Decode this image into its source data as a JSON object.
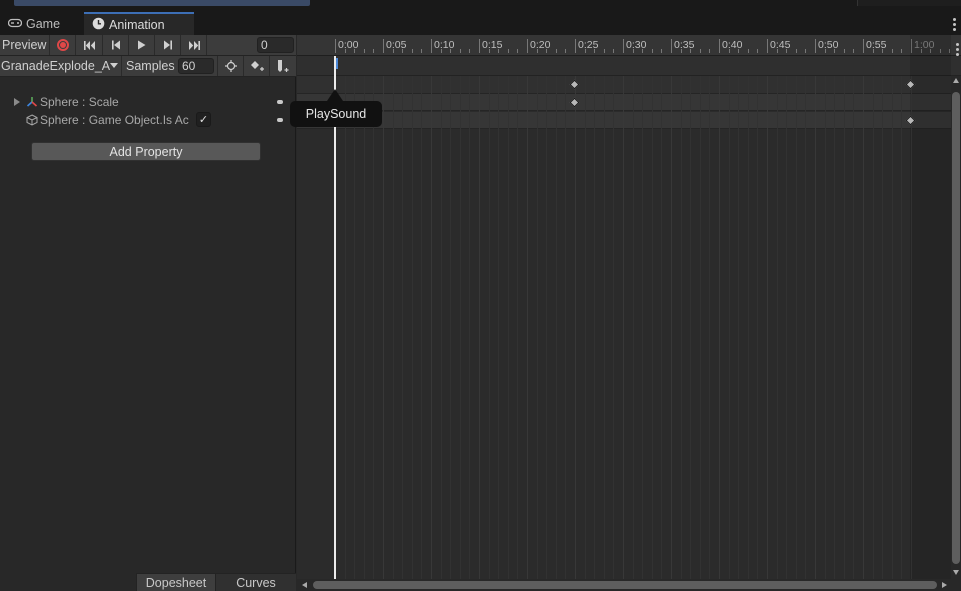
{
  "window": {
    "tabs": [
      {
        "label": "Game",
        "icon": "gamepad-icon"
      },
      {
        "label": "Animation",
        "icon": "clock-icon",
        "active": true
      }
    ]
  },
  "toolbar": {
    "preview_label": "Preview",
    "frame_value": "0",
    "clip_name": "GranadeExplode_Ar",
    "samples_label": "Samples",
    "samples_value": "60"
  },
  "properties": [
    {
      "label": "Sphere : Scale",
      "icon": "transform-icon",
      "foldable": true
    },
    {
      "label": "Sphere : Game Object.Is Ac",
      "icon": "cube-icon",
      "foldable": false,
      "checkbox": "✓"
    }
  ],
  "add_property_label": "Add Property",
  "bottom_tabs": {
    "dopesheet": "Dopesheet",
    "curves": "Curves"
  },
  "timeline": {
    "ticks": [
      "0:00",
      "0:05",
      "0:10",
      "0:15",
      "0:20",
      "0:25",
      "0:30",
      "0:35",
      "0:40",
      "0:45",
      "0:50",
      "0:55",
      "1:00"
    ],
    "tooltip": "PlaySound",
    "keyframes": {
      "summary": [
        "0:25",
        "1:00"
      ],
      "scale": [
        "0:25"
      ],
      "is_active": [
        "1:00"
      ]
    }
  },
  "colors": {
    "record": "#e04848",
    "active_tab_accent": "#3d6fb6",
    "event_marker": "#4a87d6"
  }
}
